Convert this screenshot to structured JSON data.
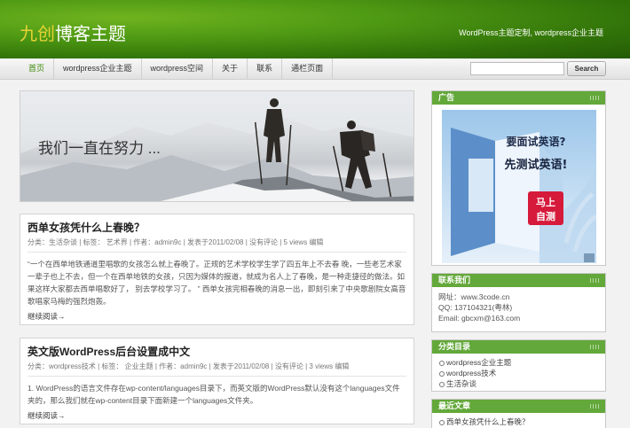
{
  "header": {
    "logo_part1": "九创",
    "logo_part2": "博客主题",
    "tagline": "WordPress主题定制, wordpress企业主题"
  },
  "nav": {
    "items": [
      "首页",
      "wordpress企业主题",
      "wordpress空间",
      "关于",
      "联系",
      "通栏页面"
    ]
  },
  "search": {
    "value": "",
    "button": "Search"
  },
  "banner": {
    "slogan": "我们一直在努力 ..."
  },
  "posts": [
    {
      "title": "西单女孩凭什么上春晚？",
      "meta": "分类：生活杂谈 | 标签： 艺术界 | 作者：admin9c | 发表于2011/02/08 | 没有评论 | 5 views 编辑",
      "excerpt": "“一个在西单地铁通道里唱歌的女孩怎么就上春晚了。正规的艺术学校学生学了四五年上不去春 晚，一些老艺术家一辈子也上不去，但一个在西单地铁的女孩，只因为媒体的报道，就成为名人上了春晚，是一种走捷径的做法。如果这样大家都去西单唱歌好了， 别去学校学习了。 ” 西单女孩完相春晚的消息一出，即刻引来了中央歌剧院女高音歌唱家马梅的强烈炮轰。",
      "more": "继续阅读→"
    },
    {
      "title": "英文版WordPress后台设置成中文",
      "meta": "分类：wordpress技术 | 标签： 企业主题 | 作者：admin9c | 发表于2011/02/08 | 没有评论 | 3 views 编辑",
      "excerpt": "1. WordPress的语言文件存在wp-content/languages目录下，而英文版的WordPress默认没有这个languages文件夹的，那么我们就在wp-content目录下面新建一个languages文件夹。",
      "more": "继续阅读→"
    }
  ],
  "sidebar": {
    "ad": {
      "title": "广告",
      "line1": "要面试英语?",
      "line2": "先测试英语!",
      "badge1": "马上",
      "badge2": "自测"
    },
    "contact": {
      "title": "联系我们",
      "lines": [
        "网址：www.3code.cn",
        "QQ: 137104321(粤林)",
        "Email: gbcxm@163.com"
      ]
    },
    "categories": {
      "title": "分类目录",
      "items": [
        "wordpress企业主题",
        "wordpress技术",
        "生活杂谈"
      ]
    },
    "recent": {
      "title": "最近文章",
      "items": [
        "西单女孩凭什么上春晚？"
      ]
    }
  }
}
